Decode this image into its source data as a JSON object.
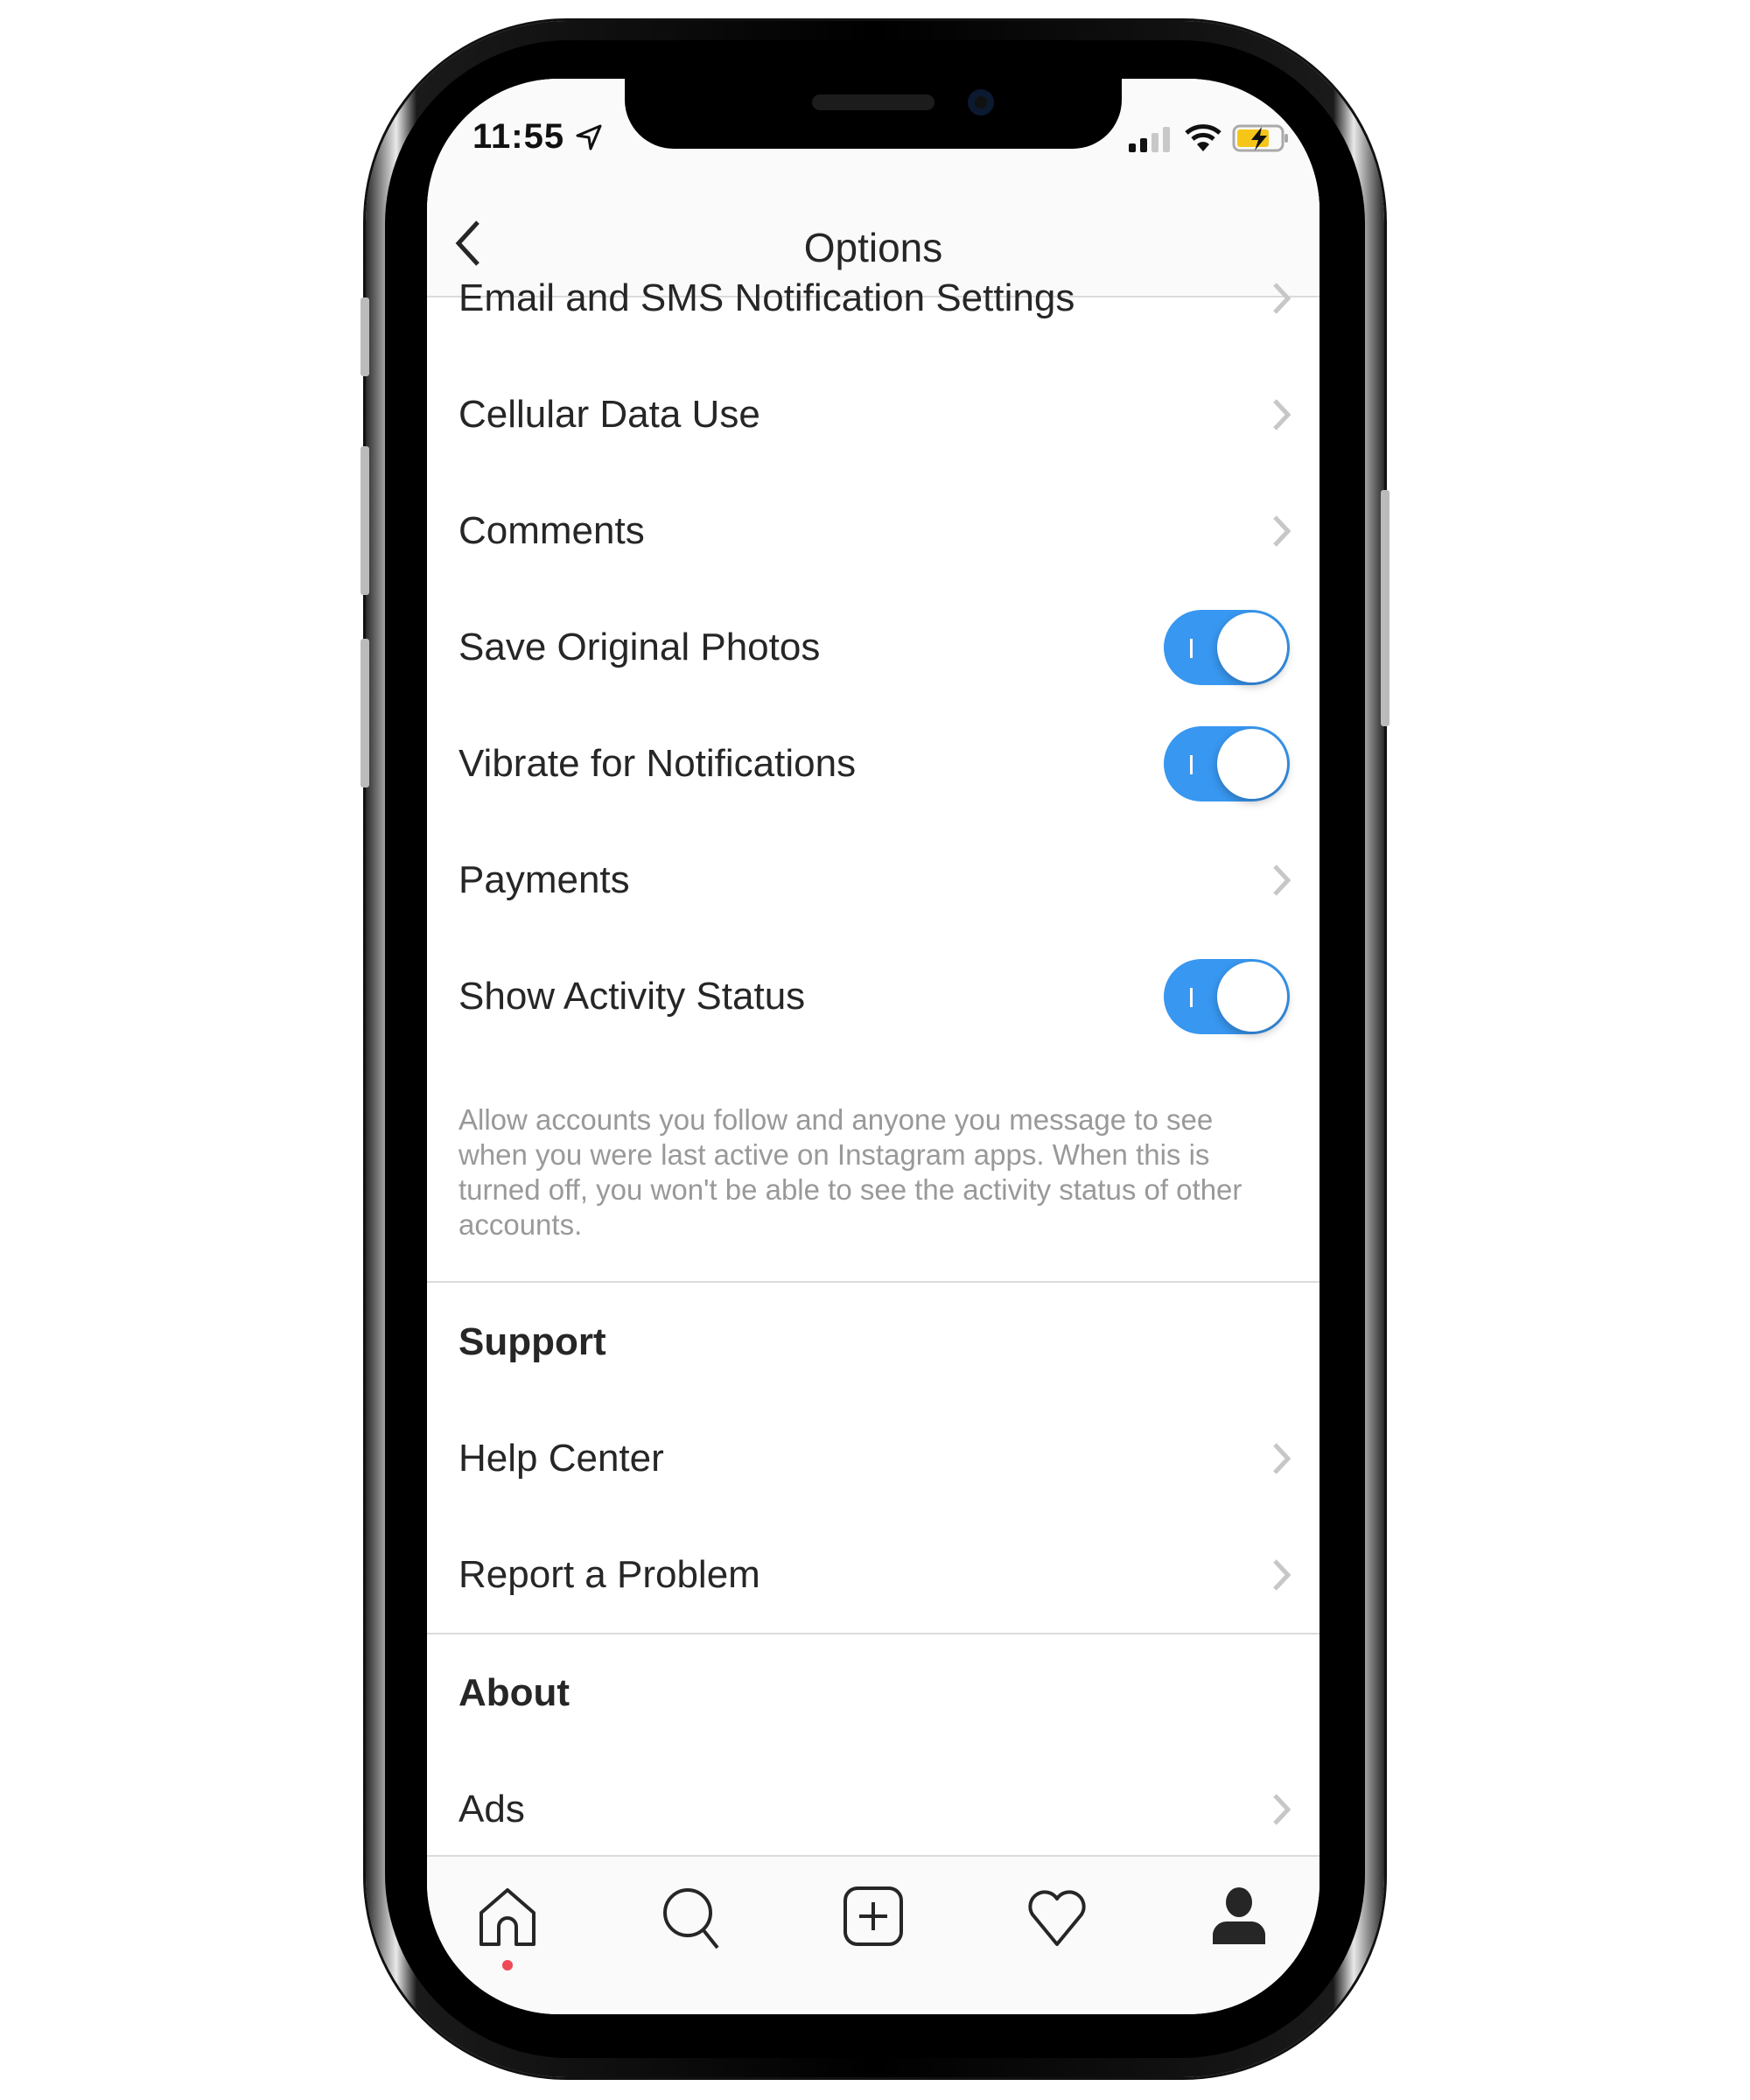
{
  "status_bar": {
    "time": "11:55",
    "location_icon": "location-arrow-icon",
    "signal_icon": "cellular-signal-icon",
    "wifi_icon": "wifi-icon",
    "battery_icon": "battery-charging-icon",
    "battery_color": "#f5c518"
  },
  "nav": {
    "title": "Options",
    "back_icon": "chevron-left-icon"
  },
  "settings": [
    {
      "label": "Email and SMS Notification Settings",
      "type": "link"
    },
    {
      "label": "Cellular Data Use",
      "type": "link"
    },
    {
      "label": "Comments",
      "type": "link"
    },
    {
      "label": "Save Original Photos",
      "type": "toggle",
      "on": true
    },
    {
      "label": "Vibrate for Notifications",
      "type": "toggle",
      "on": true
    },
    {
      "label": "Payments",
      "type": "link"
    },
    {
      "label": "Show Activity Status",
      "type": "toggle",
      "on": true
    }
  ],
  "activity_description": "Allow accounts you follow and anyone you message to see when you were last active on Instagram apps. When this is turned off, you won't be able to see the activity status of other accounts.",
  "support": {
    "header": "Support",
    "items": [
      {
        "label": "Help Center"
      },
      {
        "label": "Report a Problem"
      }
    ]
  },
  "about": {
    "header": "About",
    "items": [
      {
        "label": "Ads"
      }
    ]
  },
  "tabbar": {
    "tabs": [
      {
        "icon": "home-icon",
        "active": true
      },
      {
        "icon": "search-icon"
      },
      {
        "icon": "add-post-icon"
      },
      {
        "icon": "heart-icon"
      },
      {
        "icon": "profile-icon"
      }
    ],
    "notification_dot_color": "#ed4956"
  },
  "colors": {
    "accent": "#3897f0",
    "text": "#262626",
    "secondary": "#999999",
    "divider": "#dbdbdb"
  }
}
